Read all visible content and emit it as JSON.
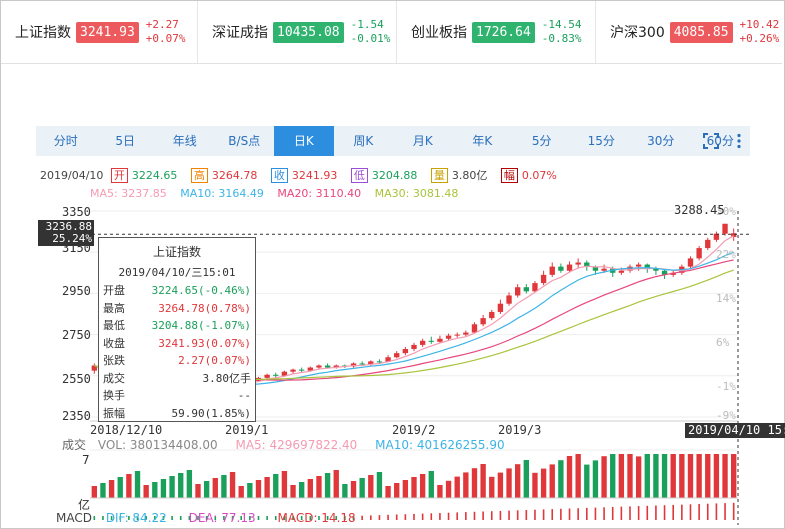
{
  "ticker": [
    {
      "name": "上证指数",
      "price": "3241.93",
      "chg": "+2.27",
      "pct": "+0.07%",
      "dir": "up"
    },
    {
      "name": "深证成指",
      "price": "10435.08",
      "chg": "-1.54",
      "pct": "-0.01%",
      "dir": "dn"
    },
    {
      "name": "创业板指",
      "price": "1726.64",
      "chg": "-14.54",
      "pct": "-0.83%",
      "dir": "dn"
    },
    {
      "name": "沪深300",
      "price": "4085.85",
      "chg": "+10.42",
      "pct": "+0.26%",
      "dir": "up"
    }
  ],
  "tabs": [
    "分时",
    "5日",
    "年线",
    "B/S点",
    "日K",
    "周K",
    "月K",
    "年K",
    "5分",
    "15分",
    "30分",
    "60分"
  ],
  "active_tab": "日K",
  "info": {
    "date": "2019/04/10",
    "open_lbl": "开",
    "open": "3224.65",
    "high_lbl": "高",
    "high": "3264.78",
    "close_lbl": "收",
    "close": "3241.93",
    "low_lbl": "低",
    "low": "3204.88",
    "vol_lbl": "量",
    "vol": "3.80亿",
    "amp_lbl": "幅",
    "amp": "0.07%"
  },
  "ma": {
    "ma5": "MA5: 3237.85",
    "ma10": "MA10: 3164.49",
    "ma20": "MA20: 3110.40",
    "ma30": "MA30: 3081.48"
  },
  "colors": {
    "up": "#e0373b",
    "down": "#1aa05b",
    "ma5": "#f49bb2",
    "ma10": "#3cb4e6",
    "ma20": "#e8467c",
    "ma30": "#a8c43c",
    "accent": "#2d8ee0"
  },
  "y_axis": [
    "3350",
    "3150",
    "2950",
    "2750",
    "2550",
    "2350"
  ],
  "pct_axis": [
    "30%",
    "22%",
    "14%",
    "6%",
    "-1%",
    "-9%"
  ],
  "x_axis": [
    "2018/12/10",
    "2019/1",
    "2019/2",
    "2019/3"
  ],
  "cursor": {
    "price": "3236.88",
    "pct": "25.24%",
    "date": "2019/04/10 15:01"
  },
  "high_mark": "3288.45",
  "tooltip": {
    "title": "上证指数",
    "datetime": "2019/04/10/三15:01",
    "rows": [
      {
        "k": "开盘",
        "v": "3224.65(-0.46%)",
        "c": "dn"
      },
      {
        "k": "最高",
        "v": "3264.78(0.78%)",
        "c": "up"
      },
      {
        "k": "最低",
        "v": "3204.88(-1.07%)",
        "c": "dn"
      },
      {
        "k": "收盘",
        "v": "3241.93(0.07%)",
        "c": "up"
      },
      {
        "k": "张跌",
        "v": "2.27(0.07%)",
        "c": "up"
      },
      {
        "k": "成交",
        "v": "3.80亿手",
        "c": "plain"
      },
      {
        "k": "换手",
        "v": "--",
        "c": "plain"
      },
      {
        "k": "振幅",
        "v": "59.90(1.85%)",
        "c": "plain"
      }
    ]
  },
  "volume": {
    "label": "成交",
    "vol": "VOL: 380134408.00",
    "ma5": "MA5: 429697822.40",
    "ma10": "MA10: 401626255.90",
    "top": "7",
    "bottom": "亿"
  },
  "macd": {
    "label": "MACD",
    "dif": "DIF: 84.22",
    "dea": "DEA: 77.13",
    "macd": "MACD: 14.18"
  },
  "chart_data": {
    "type": "candlestick",
    "ylim": [
      2350,
      3350
    ],
    "candles": [
      [
        2575,
        2600,
        2560,
        2610
      ],
      [
        2590,
        2570,
        2560,
        2595
      ],
      [
        2570,
        2580,
        2565,
        2590
      ],
      [
        2580,
        2560,
        2550,
        2585
      ],
      [
        2560,
        2565,
        2550,
        2570
      ],
      [
        2565,
        2540,
        2535,
        2570
      ],
      [
        2545,
        2550,
        2535,
        2555
      ],
      [
        2550,
        2535,
        2525,
        2555
      ],
      [
        2535,
        2530,
        2520,
        2540
      ],
      [
        2530,
        2520,
        2510,
        2535
      ],
      [
        2520,
        2510,
        2500,
        2525
      ],
      [
        2505,
        2495,
        2490,
        2510
      ],
      [
        2495,
        2500,
        2485,
        2505
      ],
      [
        2500,
        2485,
        2475,
        2505
      ],
      [
        2490,
        2500,
        2480,
        2505
      ],
      [
        2500,
        2495,
        2488,
        2508
      ],
      [
        2495,
        2520,
        2490,
        2525
      ],
      [
        2520,
        2530,
        2510,
        2535
      ],
      [
        2530,
        2525,
        2515,
        2540
      ],
      [
        2525,
        2540,
        2520,
        2545
      ],
      [
        2540,
        2555,
        2535,
        2560
      ],
      [
        2555,
        2550,
        2540,
        2565
      ],
      [
        2550,
        2570,
        2545,
        2575
      ],
      [
        2570,
        2580,
        2560,
        2585
      ],
      [
        2580,
        2575,
        2565,
        2590
      ],
      [
        2575,
        2590,
        2570,
        2595
      ],
      [
        2590,
        2600,
        2580,
        2605
      ],
      [
        2600,
        2590,
        2585,
        2610
      ],
      [
        2590,
        2600,
        2585,
        2605
      ],
      [
        2600,
        2595,
        2588,
        2605
      ],
      [
        2595,
        2610,
        2590,
        2615
      ],
      [
        2610,
        2605,
        2598,
        2620
      ],
      [
        2605,
        2620,
        2600,
        2625
      ],
      [
        2620,
        2618,
        2610,
        2630
      ],
      [
        2618,
        2640,
        2615,
        2650
      ],
      [
        2640,
        2660,
        2635,
        2670
      ],
      [
        2660,
        2680,
        2650,
        2690
      ],
      [
        2680,
        2700,
        2670,
        2710
      ],
      [
        2700,
        2720,
        2690,
        2730
      ],
      [
        2720,
        2715,
        2705,
        2740
      ],
      [
        2715,
        2730,
        2710,
        2745
      ],
      [
        2730,
        2745,
        2720,
        2755
      ],
      [
        2745,
        2750,
        2735,
        2760
      ],
      [
        2750,
        2760,
        2740,
        2770
      ],
      [
        2760,
        2800,
        2755,
        2810
      ],
      [
        2800,
        2830,
        2790,
        2845
      ],
      [
        2830,
        2860,
        2820,
        2870
      ],
      [
        2860,
        2900,
        2850,
        2920
      ],
      [
        2900,
        2940,
        2890,
        2955
      ],
      [
        2940,
        2980,
        2930,
        2995
      ],
      [
        2980,
        2960,
        2950,
        2995
      ],
      [
        2960,
        3000,
        2955,
        3010
      ],
      [
        3000,
        3040,
        2990,
        3060
      ],
      [
        3040,
        3080,
        3030,
        3100
      ],
      [
        3080,
        3060,
        3050,
        3095
      ],
      [
        3060,
        3090,
        3050,
        3105
      ],
      [
        3090,
        3100,
        3070,
        3120
      ],
      [
        3100,
        3080,
        3060,
        3110
      ],
      [
        3080,
        3060,
        3040,
        3085
      ],
      [
        3060,
        3070,
        3050,
        3090
      ],
      [
        3070,
        3050,
        3030,
        3080
      ],
      [
        3050,
        3060,
        3040,
        3075
      ],
      [
        3060,
        3080,
        3050,
        3090
      ],
      [
        3080,
        3090,
        3060,
        3100
      ],
      [
        3090,
        3070,
        3050,
        3095
      ],
      [
        3070,
        3060,
        3040,
        3080
      ],
      [
        3060,
        3040,
        3020,
        3070
      ],
      [
        3040,
        3050,
        3030,
        3060
      ],
      [
        3050,
        3080,
        3040,
        3090
      ],
      [
        3080,
        3120,
        3070,
        3130
      ],
      [
        3120,
        3170,
        3110,
        3180
      ],
      [
        3170,
        3210,
        3160,
        3220
      ],
      [
        3210,
        3240,
        3200,
        3250
      ],
      [
        3240,
        3288,
        3230,
        3288
      ],
      [
        3224,
        3242,
        3205,
        3265
      ]
    ]
  }
}
